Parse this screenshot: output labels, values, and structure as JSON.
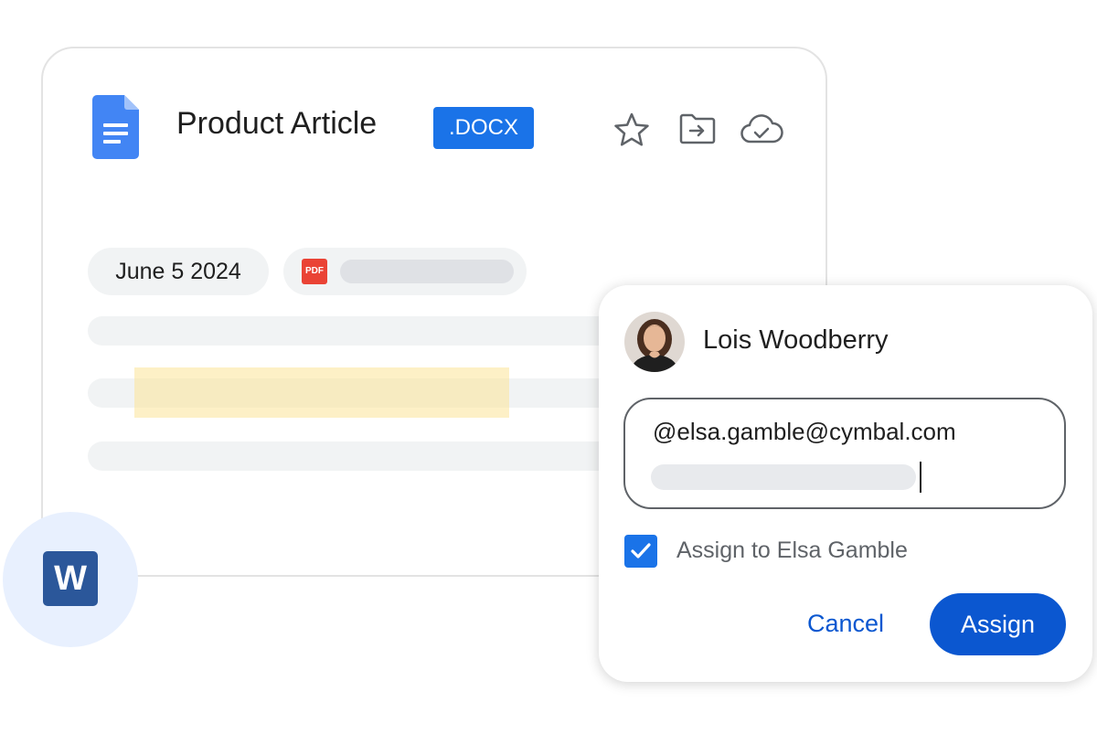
{
  "document": {
    "title": "Product Article",
    "format_badge": ".DOCX",
    "date_chip": "June 5 2024",
    "attachment_icon_label": "PDF",
    "icons": [
      "google-docs-icon",
      "star-icon",
      "move-to-folder-icon",
      "cloud-done-icon"
    ]
  },
  "word_app": {
    "icon_letter": "W",
    "icon": "microsoft-word-icon"
  },
  "assign_dialog": {
    "user_name": "Lois Woodberry",
    "mention_text": "@elsa.gamble@cymbal.com",
    "checkbox_label": "Assign to Elsa Gamble",
    "checkbox_checked": true,
    "cancel_label": "Cancel",
    "assign_label": "Assign"
  },
  "colors": {
    "accent_blue": "#1a73e8",
    "button_blue": "#0b57d0",
    "pdf_red": "#ea4335",
    "word_blue": "#2b579a",
    "highlight_yellow": "#fbe498"
  }
}
